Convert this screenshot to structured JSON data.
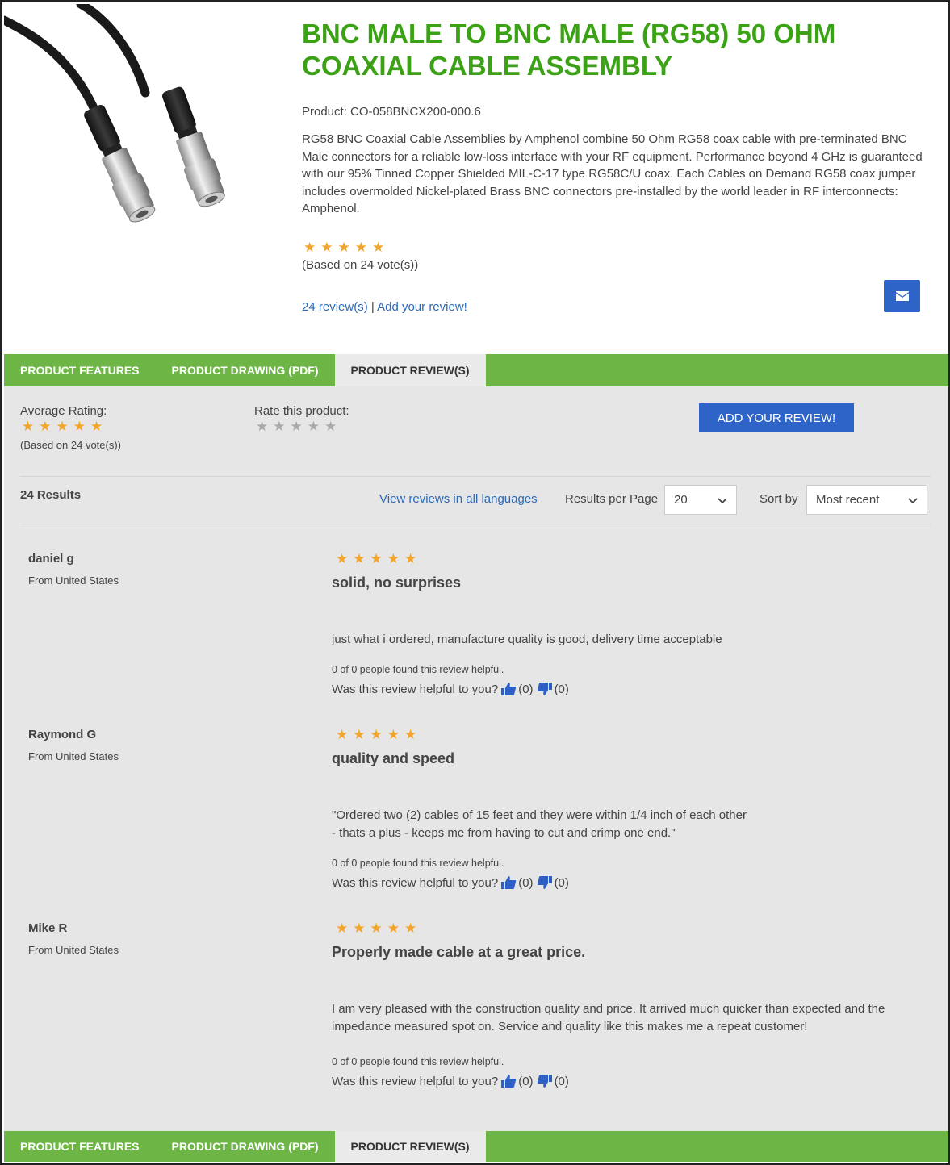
{
  "product": {
    "title": "BNC MALE TO BNC MALE (RG58) 50 OHM COAXIAL CABLE ASSEMBLY",
    "sku_text": "Product: CO-058BNCX200-000.6",
    "description": "RG58 BNC Coaxial Cable Assemblies by Amphenol combine 50 Ohm RG58 coax cable with pre-terminated BNC Male connectors for a reliable low-loss interface with your RF equipment. Performance beyond 4 GHz is guaranteed with our 95% Tinned Copper Shielded MIL-C-17 type RG58C/U coax. Each Cables on Demand RG58 coax jumper includes overmolded Nickel-plated Brass BNC connectors pre-installed by the world leader in RF interconnects: Amphenol.",
    "rating": 5,
    "votes_text": "(Based on 24 vote(s))",
    "reviews_link": "24 review(s)",
    "separator": "|",
    "add_review_link": "Add your review!",
    "mail_icon": "envelope-icon"
  },
  "tabs": [
    {
      "label": "PRODUCT FEATURES",
      "active": false
    },
    {
      "label": "PRODUCT DRAWING (PDF)",
      "active": false
    },
    {
      "label": "PRODUCT REVIEW(S)",
      "active": true
    }
  ],
  "reviews_panel": {
    "average_label": "Average Rating:",
    "average_rating": 5,
    "average_votes": "(Based on 24 vote(s))",
    "rate_label": "Rate this product:",
    "add_review_button": "ADD YOUR REVIEW!",
    "results_count": "24 Results",
    "all_languages_link": "View reviews in all languages",
    "results_per_page_label": "Results per Page",
    "results_per_page_value": "20",
    "sort_label": "Sort by",
    "sort_value": "Most recent"
  },
  "reviews": [
    {
      "name": "daniel g",
      "from": "From United States",
      "rating": 5,
      "title": "solid, no surprises",
      "body_lines": [
        "just what i ordered, manufacture quality is good, delivery time acceptable"
      ],
      "helpful_count": "0 of 0 people found this review helpful.",
      "helpful_question": "Was this review helpful to you?",
      "up_count": "(0)",
      "down_count": "(0)"
    },
    {
      "name": "Raymond G",
      "from": "From United States",
      "rating": 5,
      "title": "quality and speed",
      "body_lines": [
        "\"Ordered two (2) cables of 15 feet and they were within 1/4 inch of each other",
        "- thats a plus - keeps me from having to cut and crimp one end.\""
      ],
      "helpful_count": "0 of 0 people found this review helpful.",
      "helpful_question": "Was this review helpful to you?",
      "up_count": "(0)",
      "down_count": "(0)"
    },
    {
      "name": "Mike R",
      "from": "From United States",
      "rating": 5,
      "title": "Properly made cable at a great price.",
      "body_lines": [
        "I am very pleased with the construction quality and price. It arrived much quicker than expected and the impedance measured spot on. Service and quality like this makes me a repeat customer!"
      ],
      "helpful_count": "0 of 0 people found this review helpful.",
      "helpful_question": "Was this review helpful to you?",
      "up_count": "(0)",
      "down_count": "(0)"
    }
  ],
  "colors": {
    "title_green": "#3aa214",
    "tab_green": "#6db545",
    "button_blue": "#2e64c8",
    "link_blue": "#2b6ab8",
    "star_gold": "#f2a529"
  }
}
